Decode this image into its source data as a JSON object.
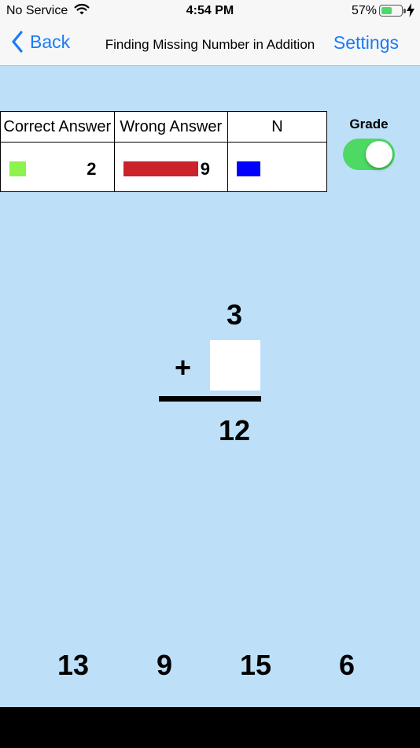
{
  "status": {
    "carrier": "No Service",
    "time": "4:54 PM",
    "battery_pct": "57%",
    "battery_level": 0.57
  },
  "nav": {
    "back_label": "Back",
    "title": "Finding Missing Number in Addition",
    "settings_label": "Settings"
  },
  "score": {
    "headers": [
      "Correct Answer",
      "Wrong Answer",
      "N"
    ],
    "rows": [
      {
        "count": "2",
        "color": "#8cf34c"
      },
      {
        "count": "9",
        "color": "#cc2229"
      },
      {
        "count": "",
        "color": "#0000ff"
      }
    ]
  },
  "grade": {
    "label": "Grade",
    "on": true
  },
  "problem": {
    "top_addend": "3",
    "operator": "+",
    "sum": "12"
  },
  "choices": [
    "13",
    "9",
    "15",
    "6"
  ],
  "colors": {
    "accent": "#1a7cf6",
    "background": "#bde0f8",
    "toggle_on": "#4cd964"
  }
}
